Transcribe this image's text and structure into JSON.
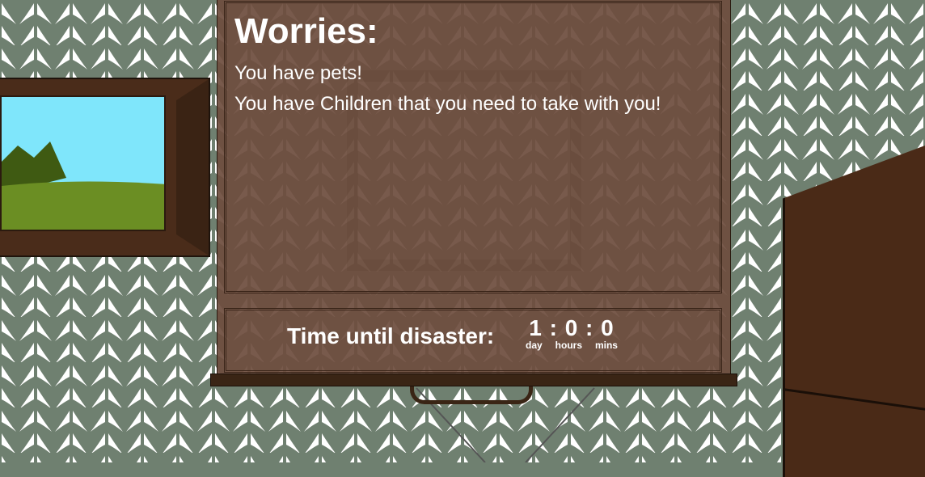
{
  "worries": {
    "title": "Worries:",
    "items": [
      "You have pets!",
      "You have Children that you need to take with you!"
    ]
  },
  "timer": {
    "label": "Time until disaster:",
    "display": "1 : 0 : 0",
    "units": {
      "day": "day",
      "hours": "hours",
      "mins": "mins"
    }
  },
  "colors": {
    "wallpaper": "#6f8070",
    "board": "#6e4e3e",
    "wood_dark": "#3a2515",
    "text": "#ffffff"
  }
}
